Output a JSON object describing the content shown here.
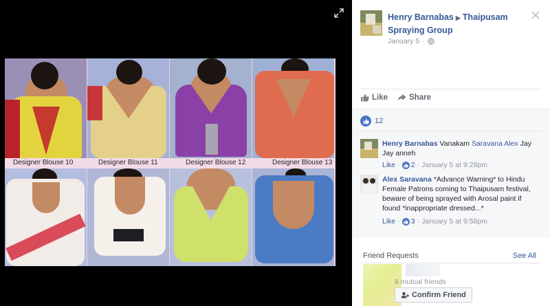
{
  "post": {
    "author": "Henry Barnabas",
    "group": "Thaipusam Spraying Group",
    "date": "January 5",
    "like_label": "Like",
    "share_label": "Share",
    "reaction_count": "12"
  },
  "photo": {
    "captions": [
      "Designer Blouse 10",
      "Designer Blouse 11",
      "Designer Blouse 12",
      "Designer Blouse 13"
    ]
  },
  "comments": [
    {
      "author": "Henry Barnabas",
      "text_before": "Vanakam ",
      "mention": "Saravana Alex",
      "text_after": " Jay Jay anneh",
      "like_label": "Like",
      "likes": "2",
      "time": "January 5 at 9:29pm"
    },
    {
      "author": "Alex Saravana",
      "text": "*Advance Warning* to Hindu Female Patrons coming to Thaipusam festival, beware of being sprayed with Arosal paint if found *inappropriate dressed...*",
      "like_label": "Like",
      "likes": "3",
      "time": "January 5 at 9:58pm"
    }
  ],
  "friend_requests": {
    "title": "Friend Requests",
    "see_all": "See All",
    "mutual": "8 mutual friends",
    "confirm_label": "Confirm Friend"
  },
  "colors": {
    "link": "#365899",
    "meta": "#90949c",
    "like_blue": "#4a76c4"
  }
}
